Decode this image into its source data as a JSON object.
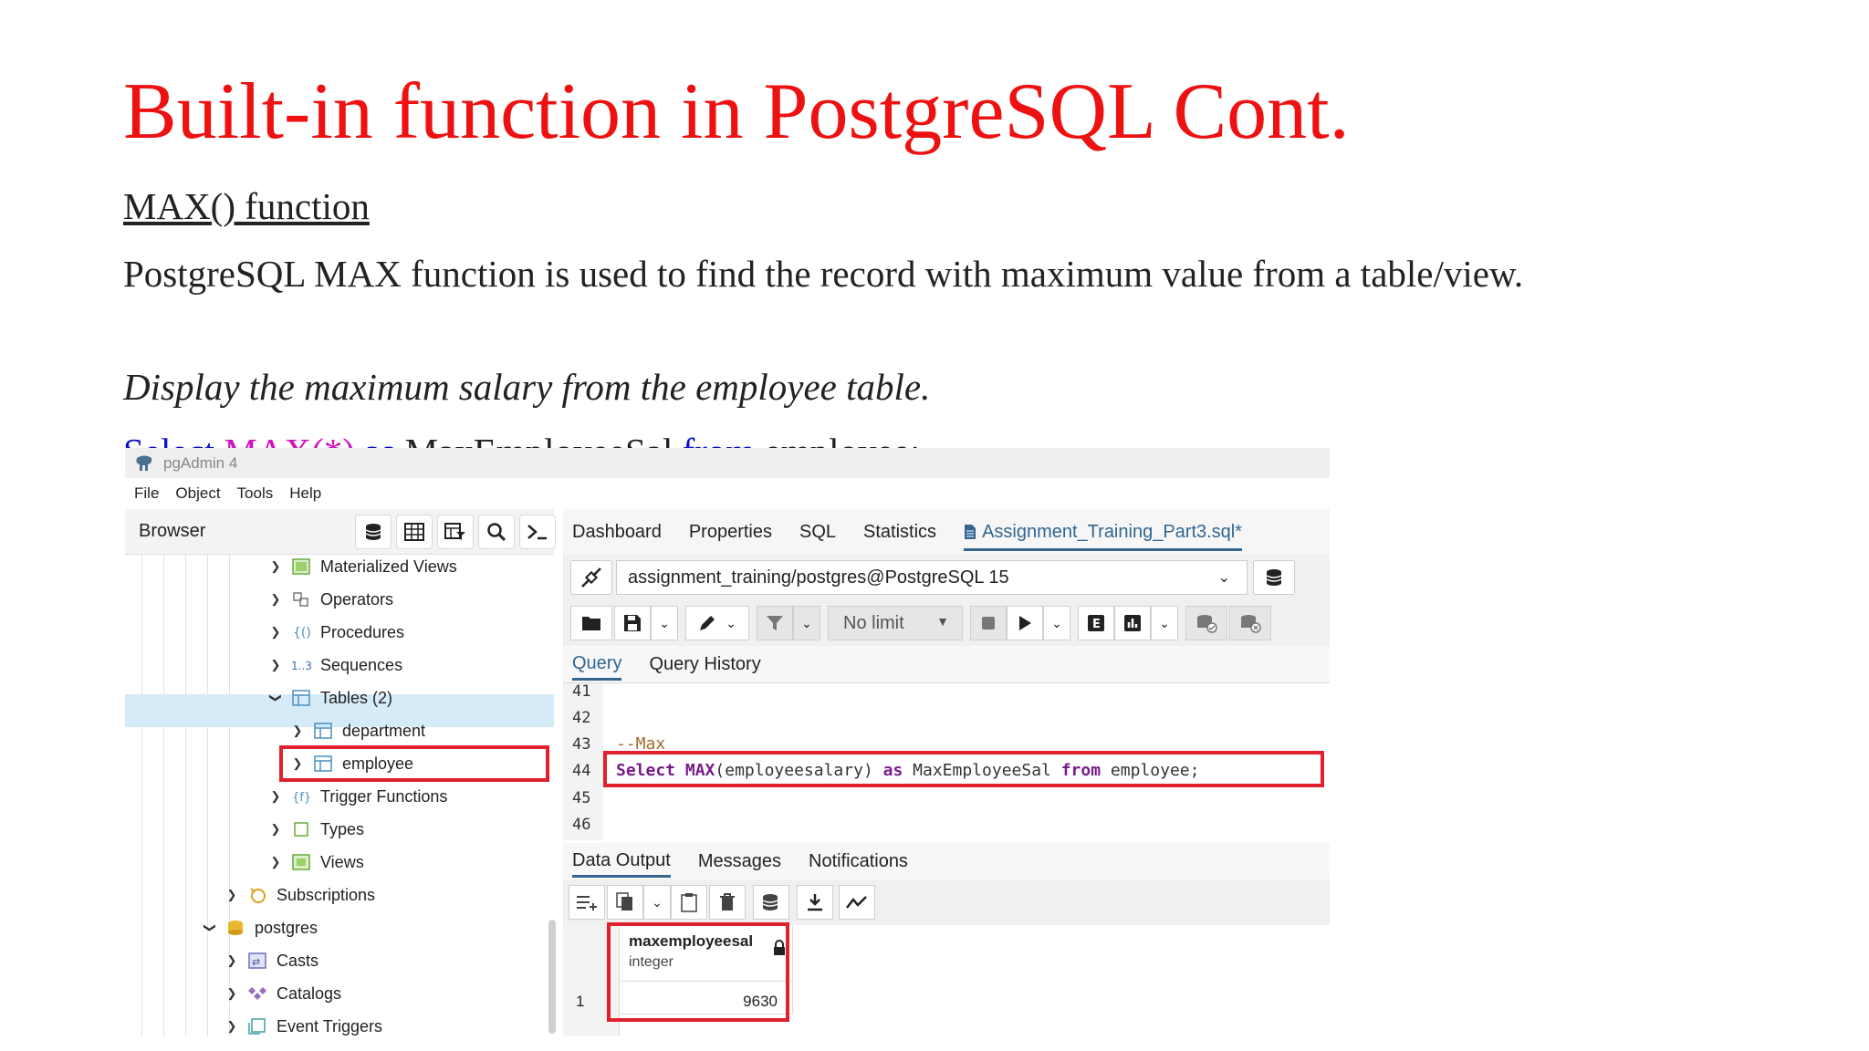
{
  "slide": {
    "title": "Built-in function in PostgreSQL Cont.",
    "subtitle": "MAX() function",
    "description": "PostgreSQL MAX function is used to find the record with maximum value from a table/view.",
    "task": "Display the maximum salary from the employee table.",
    "code_select": "Select",
    "code_max": "MAX(*)",
    "code_as": "as",
    "code_alias": "MaxEmployeeSal",
    "code_from": "from",
    "code_table": "employee;"
  },
  "window": {
    "title": "pgAdmin 4"
  },
  "menu": {
    "file": "File",
    "object": "Object",
    "tools": "Tools",
    "help": "Help"
  },
  "browser": {
    "title": "Browser",
    "tree": {
      "materialized_views": "Materialized Views",
      "operators": "Operators",
      "procedures": "Procedures",
      "sequences": "Sequences",
      "tables": "Tables (2)",
      "department": "department",
      "employee": "employee",
      "trigger_functions": "Trigger Functions",
      "types": "Types",
      "views": "Views",
      "subscriptions": "Subscriptions",
      "postgres": "postgres",
      "casts": "Casts",
      "catalogs": "Catalogs",
      "event_triggers": "Event Triggers"
    }
  },
  "tabs": {
    "dashboard": "Dashboard",
    "properties": "Properties",
    "sql": "SQL",
    "statistics": "Statistics",
    "query_file": "Assignment_Training_Part3.sql*"
  },
  "connection": {
    "value": "assignment_training/postgres@PostgreSQL 15"
  },
  "toolbar": {
    "limit": "No limit"
  },
  "query_tabs": {
    "query": "Query",
    "history": "Query History"
  },
  "editor": {
    "lines": [
      "41",
      "42",
      "43",
      "44",
      "45",
      "46"
    ],
    "comment": "--Max",
    "kw_select": "Select",
    "fn_max": "MAX",
    "args": "(employeesalary)",
    "kw_as": "as",
    "alias": "MaxEmployeeSal",
    "kw_from": "from",
    "table": "employee;"
  },
  "output_tabs": {
    "data": "Data Output",
    "messages": "Messages",
    "notifications": "Notifications"
  },
  "result": {
    "column_name": "maxemployeesal",
    "column_type": "integer",
    "row_index": "1",
    "value": "9630"
  },
  "colors": {
    "title_red": "#ee1111",
    "highlight_red": "#e0202e",
    "accent_blue": "#326690",
    "selection": "#d6ebf8"
  }
}
